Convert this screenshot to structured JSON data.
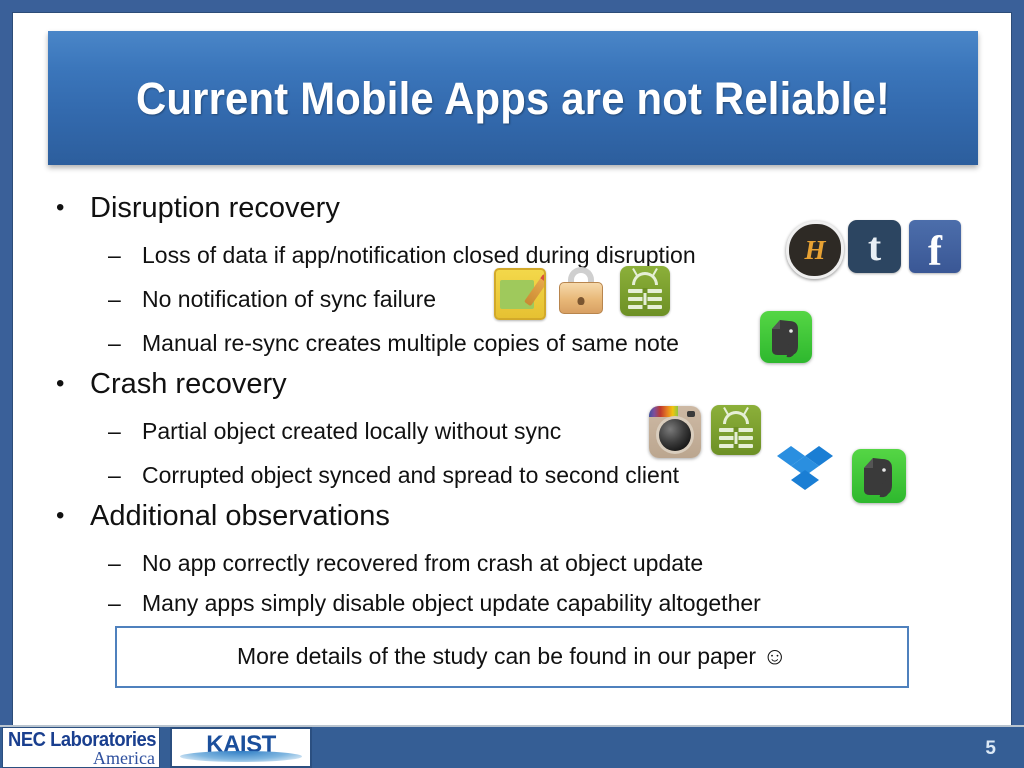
{
  "slide": {
    "title": "Current Mobile Apps are not Reliable!",
    "page_number": "5",
    "accent_color": "#3a6099",
    "title_gradient_top": "#4a86c8",
    "title_gradient_bottom": "#2c5e9d"
  },
  "bullets": [
    {
      "bullet_glyph": "•",
      "text": "Disruption recovery",
      "sub": [
        {
          "dash": "–",
          "text": "Loss of data if app/notification closed during disruption"
        },
        {
          "dash": "–",
          "text": "No notification of sync failure"
        },
        {
          "dash": "–",
          "text": "Manual re-sync creates multiple copies of same note"
        }
      ]
    },
    {
      "bullet_glyph": "•",
      "text": "Crash recovery",
      "sub": [
        {
          "dash": "–",
          "text": "Partial object created locally without sync"
        },
        {
          "dash": "–",
          "text": "Corrupted object synced and spread to second client"
        }
      ]
    },
    {
      "bullet_glyph": "•",
      "text": "Additional observations",
      "sub": [
        {
          "dash": "–",
          "text": "No app correctly recovered from crash at object update"
        },
        {
          "dash": "–",
          "text": "Many apps simply disable object update capability altogether"
        }
      ]
    }
  ],
  "app_icons": {
    "hancom_letter": "H",
    "tumblr_letter": "t",
    "facebook_letter": "f",
    "row1_labels": [
      "hancom-icon",
      "tumblr-icon",
      "facebook-icon"
    ],
    "row2_labels": [
      "colornote-icon",
      "padlock-icon",
      "keepassdroid-icon"
    ],
    "row3_labels": [
      "evernote-icon"
    ],
    "row4_labels": [
      "instagram-icon",
      "keepassdroid-icon"
    ],
    "row5_labels": [
      "dropbox-icon",
      "evernote-icon"
    ]
  },
  "callout": {
    "text": "More details of the study can be found in our paper",
    "smiley": "☺",
    "border_color": "#4f81bd"
  },
  "footer": {
    "nec_line1": "NEC Laboratories",
    "nec_line2": "America",
    "kaist": "KAIST",
    "band_color": "#355e95"
  }
}
